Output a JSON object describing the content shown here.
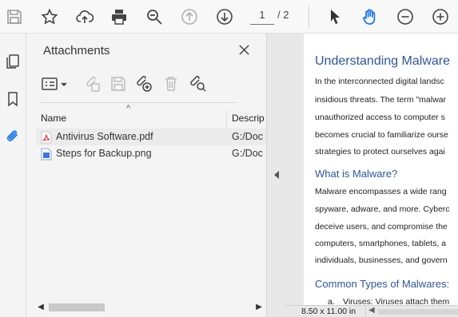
{
  "toolbar": {
    "page_current": "1",
    "page_total": "/ 2",
    "icons": [
      "save-icon",
      "bookmark-star-icon",
      "upload-cloud-icon",
      "print-icon",
      "zoom-search-icon",
      "page-up-icon",
      "page-down-icon",
      "select-cursor-icon",
      "hand-tool-icon",
      "zoom-out-icon",
      "zoom-in-icon"
    ]
  },
  "rail": {
    "icons": [
      "page-thumbnails-icon",
      "bookmarks-icon",
      "attachments-paperclip-icon"
    ]
  },
  "panel": {
    "title": "Attachments",
    "columns": {
      "name": "Name",
      "description": "Descrip"
    },
    "files": [
      {
        "name": "Antivirus Software.pdf",
        "desc": "G:/Doc",
        "type": "pdf"
      },
      {
        "name": "Steps for Backup.png",
        "desc": "G:/Doc",
        "type": "png"
      }
    ]
  },
  "document": {
    "title": "Understanding Malware",
    "intro": [
      "In the interconnected digital landsc",
      "insidious threats. The term \"malwar",
      "unauthorized access to computer s",
      "becomes crucial to familiarize ourse",
      "strategies to protect ourselves agai"
    ],
    "h2_what": "What is Malware?",
    "what": [
      "Malware encompasses a wide rang",
      "spyware, adware, and more. Cyberc",
      "deceive users, and compromise the",
      "computers, smartphones, tablets, a",
      "individuals, businesses, and govern"
    ],
    "h2_types": "Common Types of Malwares:",
    "list_marker": "a.",
    "list_first": "Viruses: Viruses attach them",
    "page_size": "8.50 x 11.00 in"
  },
  "colors": {
    "accent_blue": "#2f5597",
    "active_tool_blue": "#1473e6"
  }
}
